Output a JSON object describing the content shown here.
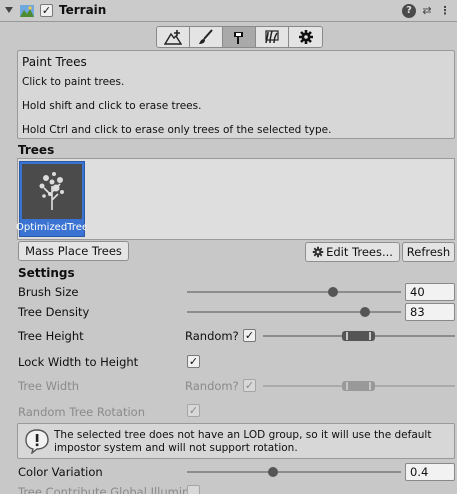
{
  "component": {
    "title": "Terrain",
    "enabled_check": "✓",
    "help_symbol": "?",
    "preset_symbol": "⇄",
    "menu_symbol": "⋮"
  },
  "toolbar": {
    "tools": [
      "raise-lower-terrain",
      "paint-texture",
      "paint-trees",
      "paint-details",
      "terrain-settings"
    ],
    "active_index": 2
  },
  "help": {
    "title": "Paint Trees",
    "lines": [
      "Click to paint trees.",
      "Hold shift and click to erase trees.",
      "Hold Ctrl and click to erase only trees of the selected type."
    ]
  },
  "trees": {
    "header": "Trees",
    "items": [
      {
        "name": "OptimizedTree"
      }
    ]
  },
  "buttons": {
    "mass_place": "Mass Place Trees",
    "edit_trees": "Edit Trees...",
    "refresh": "Refresh"
  },
  "settings": {
    "header": "Settings",
    "brush_size": {
      "label": "Brush Size",
      "value": "40",
      "fraction": 0.68
    },
    "tree_density": {
      "label": "Tree Density",
      "value": "83",
      "fraction": 0.83
    },
    "tree_height": {
      "label": "Tree Height",
      "random_label": "Random?",
      "random_checked": "✓"
    },
    "lock_width": {
      "label": "Lock Width to Height",
      "checked": "✓"
    },
    "tree_width": {
      "label": "Tree Width",
      "random_label": "Random?",
      "random_checked": "✓"
    },
    "random_rotation": {
      "label": "Random Tree Rotation",
      "checked": "✓"
    },
    "warning": "The selected tree does not have an LOD group, so it will use the default impostor system and will not support rotation.",
    "color_variation": {
      "label": "Color Variation",
      "value": "0.4",
      "fraction": 0.4
    },
    "global_illum": {
      "label": "Tree Contribute Global Illumin"
    }
  },
  "colors": {
    "selection": "#3a73d1",
    "panel": "#c8c8c8",
    "field": "#f2f2f2"
  }
}
